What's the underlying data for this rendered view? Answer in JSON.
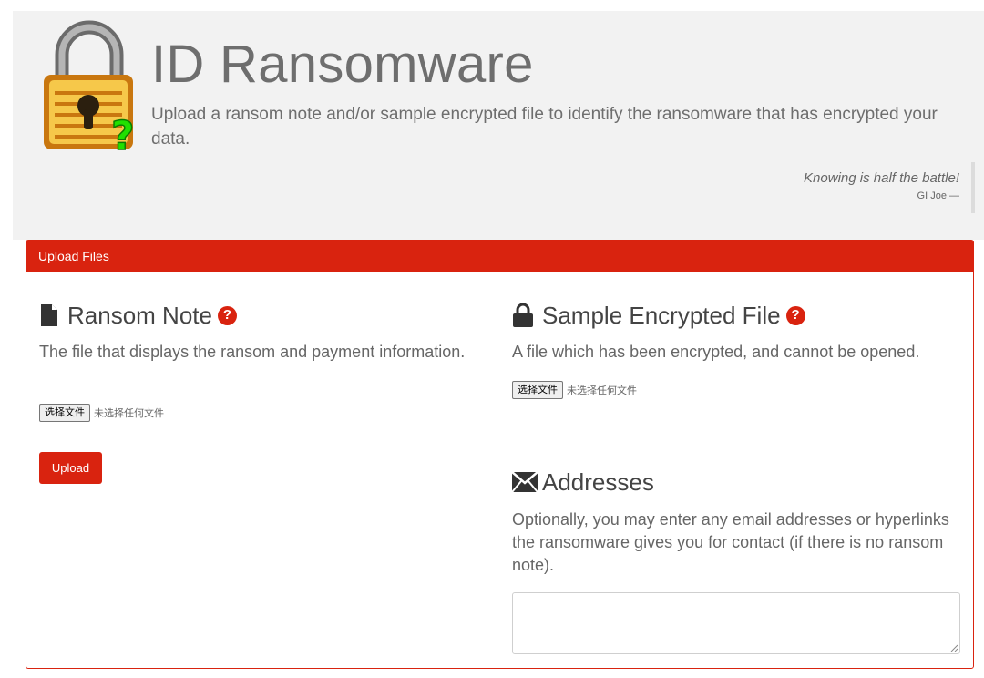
{
  "header": {
    "title": "ID Ransomware",
    "lead": "Upload a ransom note and/or sample encrypted file to identify the ransomware that has encrypted your data.",
    "quote": "Knowing is half the battle!",
    "quote_author": "GI Joe —",
    "logo_icon": "padlock-question-icon"
  },
  "panel": {
    "heading": "Upload Files",
    "ransom_note": {
      "title": "Ransom Note",
      "icon": "file-icon",
      "help": "?",
      "description": "The file that displays the ransom and payment information.",
      "file_button": "选择文件",
      "file_status": "未选择任何文件"
    },
    "encrypted_file": {
      "title": "Sample Encrypted File",
      "icon": "lock-icon",
      "help": "?",
      "description": "A file which has been encrypted, and cannot be opened.",
      "file_button": "选择文件",
      "file_status": "未选择任何文件"
    },
    "upload_button": "Upload",
    "addresses": {
      "title": "Addresses",
      "icon": "envelope-icon",
      "description": "Optionally, you may enter any email addresses or hyperlinks the ransomware gives you for contact (if there is no ransom note).",
      "value": ""
    }
  },
  "colors": {
    "accent": "#d9230f",
    "jumbotron_bg": "#f2f2f2",
    "text_muted": "#6e6e6e"
  }
}
